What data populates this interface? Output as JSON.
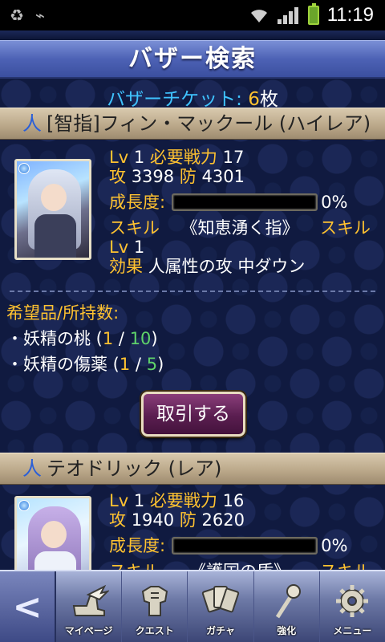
{
  "status_bar": {
    "time": "11:19"
  },
  "title": "バザー検索",
  "ticket": {
    "label": "バザーチケット: ",
    "count": "6",
    "unit": "枚"
  },
  "cards": [
    {
      "race": "人",
      "name": "[智指]フィン・マックール (ハイレア)",
      "lv_label": "Lv",
      "lv": "1",
      "power_label": "必要戦力",
      "power": "17",
      "atk_label": "攻",
      "atk": "3398",
      "def_label": "防",
      "def": "4301",
      "growth_label": "成長度:",
      "growth_pct": "0%",
      "growth_value": 0,
      "skill_label": "スキル",
      "skill_name": "《知恵湧く指》",
      "skill_label2": "スキル",
      "skill_lv_label": "Lv",
      "skill_lv": "1",
      "effect_label": "効果",
      "effect": "人属性の攻 中ダウン"
    },
    {
      "race": "人",
      "name": "テオドリック (レア)",
      "lv_label": "Lv",
      "lv": "1",
      "power_label": "必要戦力",
      "power": "16",
      "atk_label": "攻",
      "atk": "1940",
      "def_label": "防",
      "def": "2620",
      "growth_label": "成長度:",
      "growth_pct": "0%",
      "growth_value": 0,
      "skill_label": "スキル",
      "skill_name": "《護国の盾》",
      "skill_label2": "スキル"
    }
  ],
  "wish": {
    "label_a": "希望品",
    "label_b": "/所持数:",
    "items": [
      {
        "bullet": "・",
        "name": "妖精の桃",
        "open": " (",
        "count": "1",
        "sep": " / ",
        "total": "10",
        "close": ")"
      },
      {
        "bullet": "・",
        "name": "妖精の傷薬",
        "open": " (",
        "count": "1",
        "sep": " / ",
        "total": "5",
        "close": ")"
      }
    ]
  },
  "trade_button": "取引する",
  "nav": {
    "back": "<",
    "items": [
      {
        "label": "マイページ",
        "icon": "winged-boot-icon"
      },
      {
        "label": "クエスト",
        "icon": "armor-icon"
      },
      {
        "label": "ガチャ",
        "icon": "cards-icon"
      },
      {
        "label": "強化",
        "icon": "staff-icon"
      },
      {
        "label": "メニュー",
        "icon": "gear-icon"
      }
    ]
  }
}
